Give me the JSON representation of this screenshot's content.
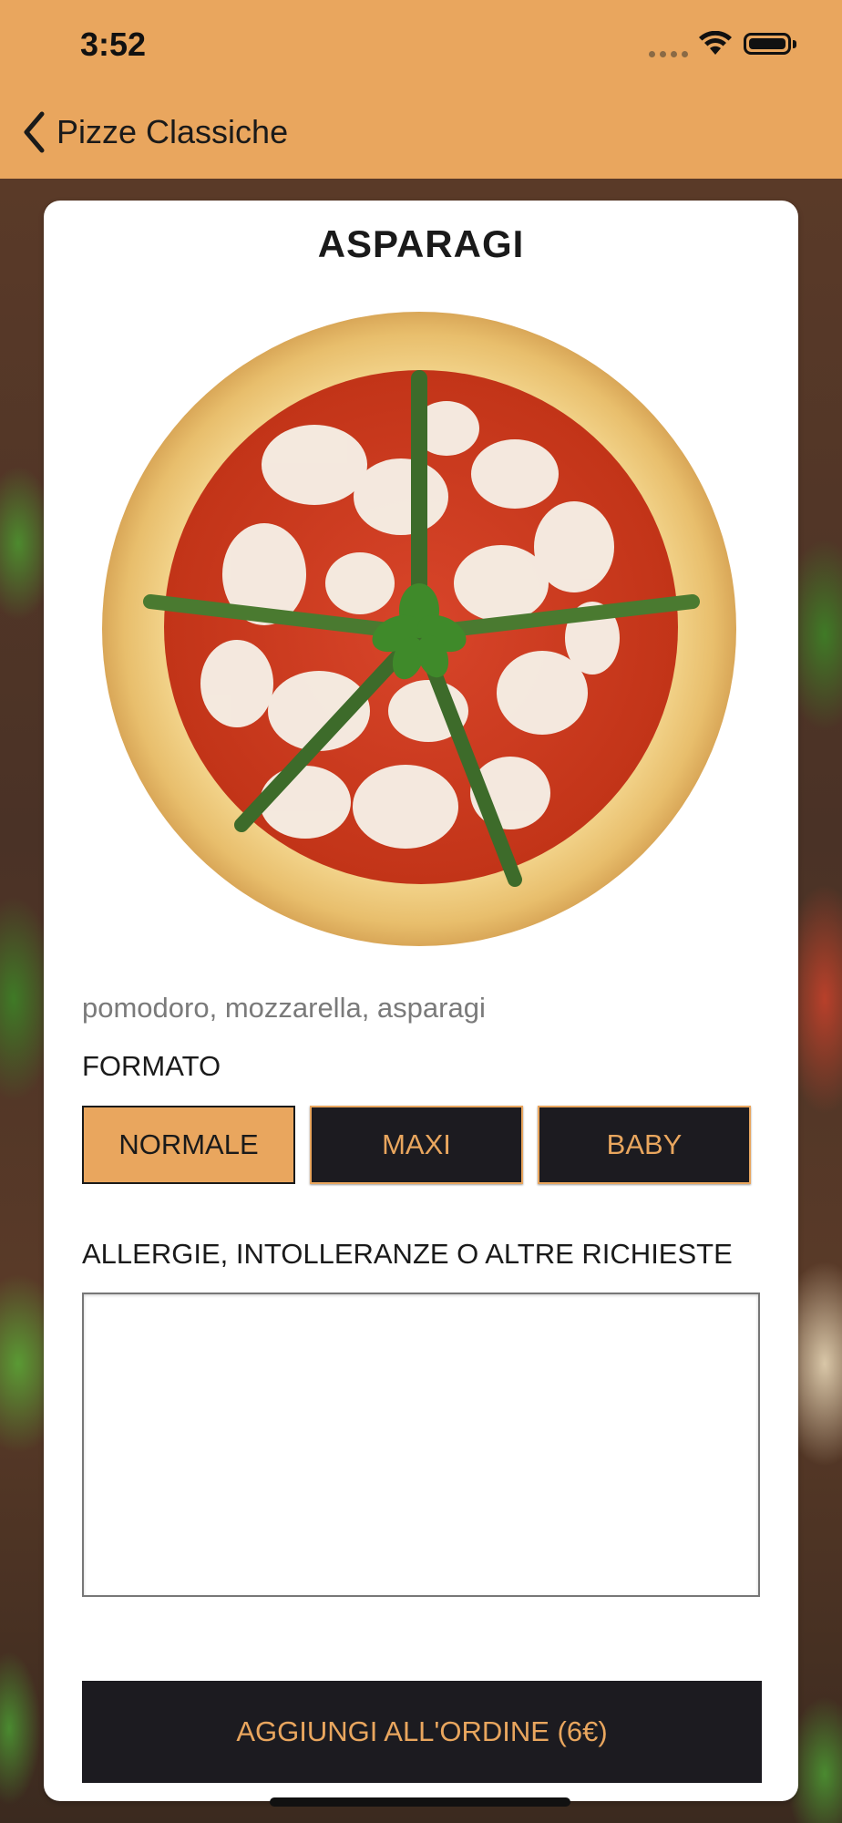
{
  "status_bar": {
    "time": "3:52"
  },
  "nav": {
    "back_label": "Pizze Classiche"
  },
  "product": {
    "title": "ASPARAGI",
    "ingredients": "pomodoro, mozzarella, asparagi"
  },
  "format": {
    "label": "FORMATO",
    "options": [
      "NORMALE",
      "MAXI",
      "BABY"
    ],
    "selected": "NORMALE"
  },
  "notes": {
    "label": "ALLERGIE, INTOLLERANZE O ALTRE RICHIESTE",
    "value": ""
  },
  "add_button": {
    "label": "AGGIUNGI ALL'ORDINE (6€)"
  },
  "colors": {
    "accent": "#e9a65e",
    "dark": "#1c1b20",
    "card": "#ffffff"
  }
}
